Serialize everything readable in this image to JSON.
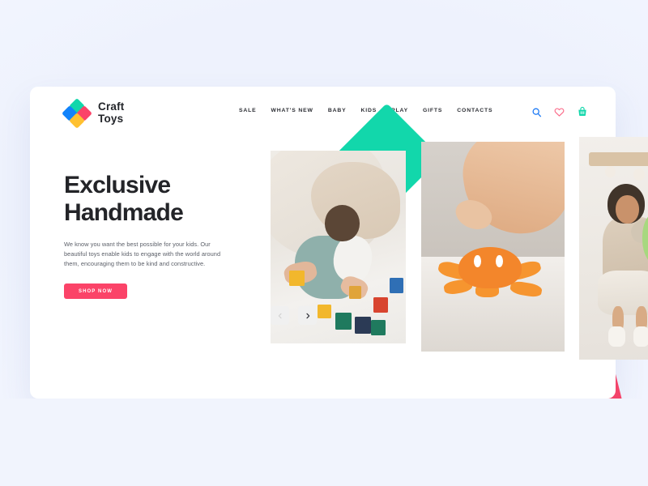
{
  "brand": {
    "name_line1": "Craft",
    "name_line2": "Toys",
    "logo_icon": "diamond-logo-icon",
    "colors": {
      "teal": "#12d7ab",
      "blue": "#1183fb",
      "pink": "#fb4368",
      "yellow": "#ffc130"
    }
  },
  "nav": {
    "items": [
      {
        "label": "SALE"
      },
      {
        "label": "WHAT'S NEW"
      },
      {
        "label": "BABY"
      },
      {
        "label": "KIDS"
      },
      {
        "label": "PLAY"
      },
      {
        "label": "GIFTS"
      },
      {
        "label": "CONTACTS"
      }
    ]
  },
  "actions": {
    "search": {
      "icon": "search-icon",
      "color": "#1f7bf5"
    },
    "wishlist": {
      "icon": "heart-icon",
      "color": "#fb6f8d"
    },
    "cart": {
      "icon": "shopping-basket-icon",
      "color": "#12d7ab"
    }
  },
  "hero": {
    "title": "Exclusive\nHandmade",
    "subtitle": "We know you want the best possible for your kids. Our beautiful toys enable kids to engage with the world around them, encouraging them to be kind and constructive.",
    "cta_label": "SHOP NOW",
    "cta_color": "#fb4368"
  },
  "carousel": {
    "prev_icon": "chevron-left-icon",
    "next_icon": "chevron-right-icon",
    "slides": [
      {
        "alt": "Baby playing with wooden blocks on floor"
      },
      {
        "alt": "Hand reaching for orange octopus toy"
      },
      {
        "alt": "Girl holding green dinosaur toy"
      }
    ]
  },
  "decor": {
    "teal_diamond": "#12d7ab",
    "blue_square": "#0b83fb",
    "yellow_diamond": "#fdb72a",
    "pink_square": "#fb4368",
    "page_background": "#f1f4fd"
  }
}
